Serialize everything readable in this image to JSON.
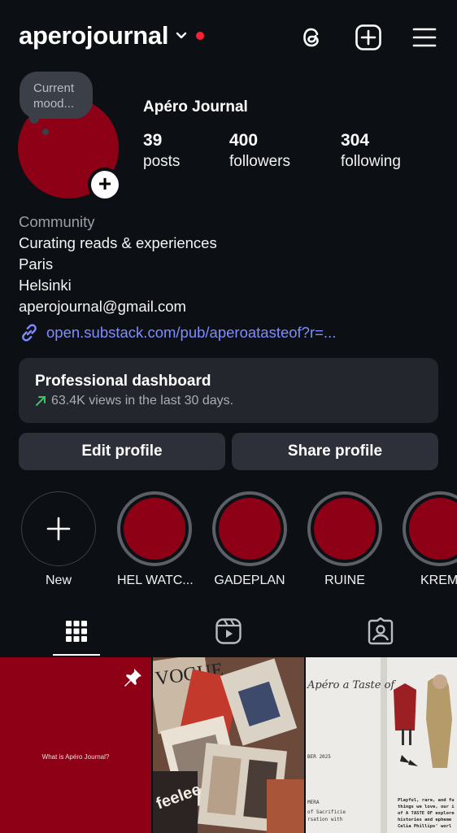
{
  "header": {
    "username": "aperojournal",
    "icons": [
      "chevron-down-icon",
      "notification-dot",
      "threads-icon",
      "create-plus-icon",
      "menu-icon"
    ],
    "accent_color": "#ff1f35"
  },
  "profile": {
    "mood_note": "Current mood...",
    "full_name": "Apéro Journal",
    "avatar_color": "#8d0016",
    "stats": [
      {
        "value": "39",
        "label": "posts"
      },
      {
        "value": "400",
        "label": "followers"
      },
      {
        "value": "304",
        "label": "following"
      }
    ]
  },
  "bio": {
    "category": "Community",
    "lines": [
      "Curating reads & experiences",
      "Paris",
      "Helsinki",
      "aperojournal@gmail.com"
    ],
    "link": "open.substack.com/pub/aperoatasteof?r=..."
  },
  "dashboard": {
    "title": "Professional dashboard",
    "subtitle": "63.4K views in the last 30 days."
  },
  "buttons": {
    "edit": "Edit profile",
    "share": "Share profile"
  },
  "highlights": [
    {
      "label": "New"
    },
    {
      "label": "HEL WATC..."
    },
    {
      "label": "GADEPLAN"
    },
    {
      "label": "RUINE"
    },
    {
      "label": "KREM"
    }
  ],
  "tabs": [
    "grid-icon",
    "reels-icon",
    "tagged-icon"
  ],
  "grid": {
    "post1_text": "What is Apéro Journal?",
    "post3_text": {
      "title": "Apéro a Taste of",
      "date": "BER 2025",
      "left": [
        "MERA",
        "of Sacrificie",
        "rsation with"
      ],
      "right": [
        "Playful, rare, and fu",
        "things we love, our i",
        "of A TASTE OF explore",
        "histories and epheme",
        "Celia Phillips' worl"
      ]
    }
  }
}
